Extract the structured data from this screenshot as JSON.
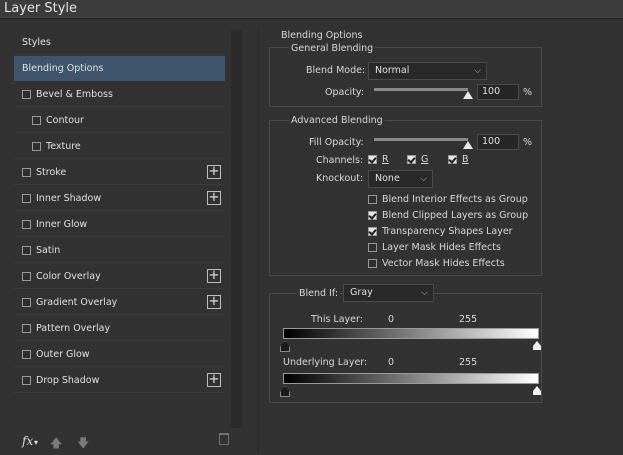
{
  "window": {
    "title": "Layer Style"
  },
  "sidebar": {
    "items": [
      {
        "label": "Styles",
        "checkbox": false,
        "plus": false,
        "indent": 0,
        "selected": false
      },
      {
        "label": "Blending Options",
        "checkbox": false,
        "plus": false,
        "indent": 0,
        "selected": true
      },
      {
        "label": "Bevel & Emboss",
        "checkbox": true,
        "plus": false,
        "indent": 0,
        "selected": false
      },
      {
        "label": "Contour",
        "checkbox": true,
        "plus": false,
        "indent": 1,
        "selected": false
      },
      {
        "label": "Texture",
        "checkbox": true,
        "plus": false,
        "indent": 1,
        "selected": false
      },
      {
        "label": "Stroke",
        "checkbox": true,
        "plus": true,
        "indent": 0,
        "selected": false
      },
      {
        "label": "Inner Shadow",
        "checkbox": true,
        "plus": true,
        "indent": 0,
        "selected": false
      },
      {
        "label": "Inner Glow",
        "checkbox": true,
        "plus": false,
        "indent": 0,
        "selected": false
      },
      {
        "label": "Satin",
        "checkbox": true,
        "plus": false,
        "indent": 0,
        "selected": false
      },
      {
        "label": "Color Overlay",
        "checkbox": true,
        "plus": true,
        "indent": 0,
        "selected": false
      },
      {
        "label": "Gradient Overlay",
        "checkbox": true,
        "plus": true,
        "indent": 0,
        "selected": false
      },
      {
        "label": "Pattern Overlay",
        "checkbox": true,
        "plus": false,
        "indent": 0,
        "selected": false
      },
      {
        "label": "Outer Glow",
        "checkbox": true,
        "plus": false,
        "indent": 0,
        "selected": false
      },
      {
        "label": "Drop Shadow",
        "checkbox": true,
        "plus": true,
        "indent": 0,
        "selected": false
      }
    ],
    "plus_symbol": "+",
    "fx_label": "fx"
  },
  "blending": {
    "section_title": "Blending Options",
    "general_title": "General Blending",
    "blend_mode_label": "Blend Mode:",
    "blend_mode_value": "Normal",
    "opacity_label": "Opacity:",
    "opacity_value": "100",
    "opacity_unit": "%",
    "opacity_percent": 100,
    "advanced_title": "Advanced Blending",
    "fill_opacity_label": "Fill Opacity:",
    "fill_opacity_value": "100",
    "fill_opacity_unit": "%",
    "fill_opacity_percent": 100,
    "channels_label": "Channels:",
    "channels": [
      {
        "label": "R",
        "checked": true
      },
      {
        "label": "G",
        "checked": true
      },
      {
        "label": "B",
        "checked": true
      }
    ],
    "knockout_label": "Knockout:",
    "knockout_value": "None",
    "options": [
      {
        "label": "Blend Interior Effects as Group",
        "checked": false
      },
      {
        "label": "Blend Clipped Layers as Group",
        "checked": true
      },
      {
        "label": "Transparency Shapes Layer",
        "checked": true
      },
      {
        "label": "Layer Mask Hides Effects",
        "checked": false
      },
      {
        "label": "Vector Mask Hides Effects",
        "checked": false
      }
    ],
    "blend_if_label": "Blend If:",
    "blend_if_value": "Gray",
    "this_layer_label": "This Layer:",
    "this_layer_min": "0",
    "this_layer_max": "255",
    "underlying_label": "Underlying Layer:",
    "underlying_min": "0",
    "underlying_max": "255"
  },
  "colors": {
    "background": "#323232",
    "selection": "#3f556d",
    "text": "#d8d8d8"
  }
}
